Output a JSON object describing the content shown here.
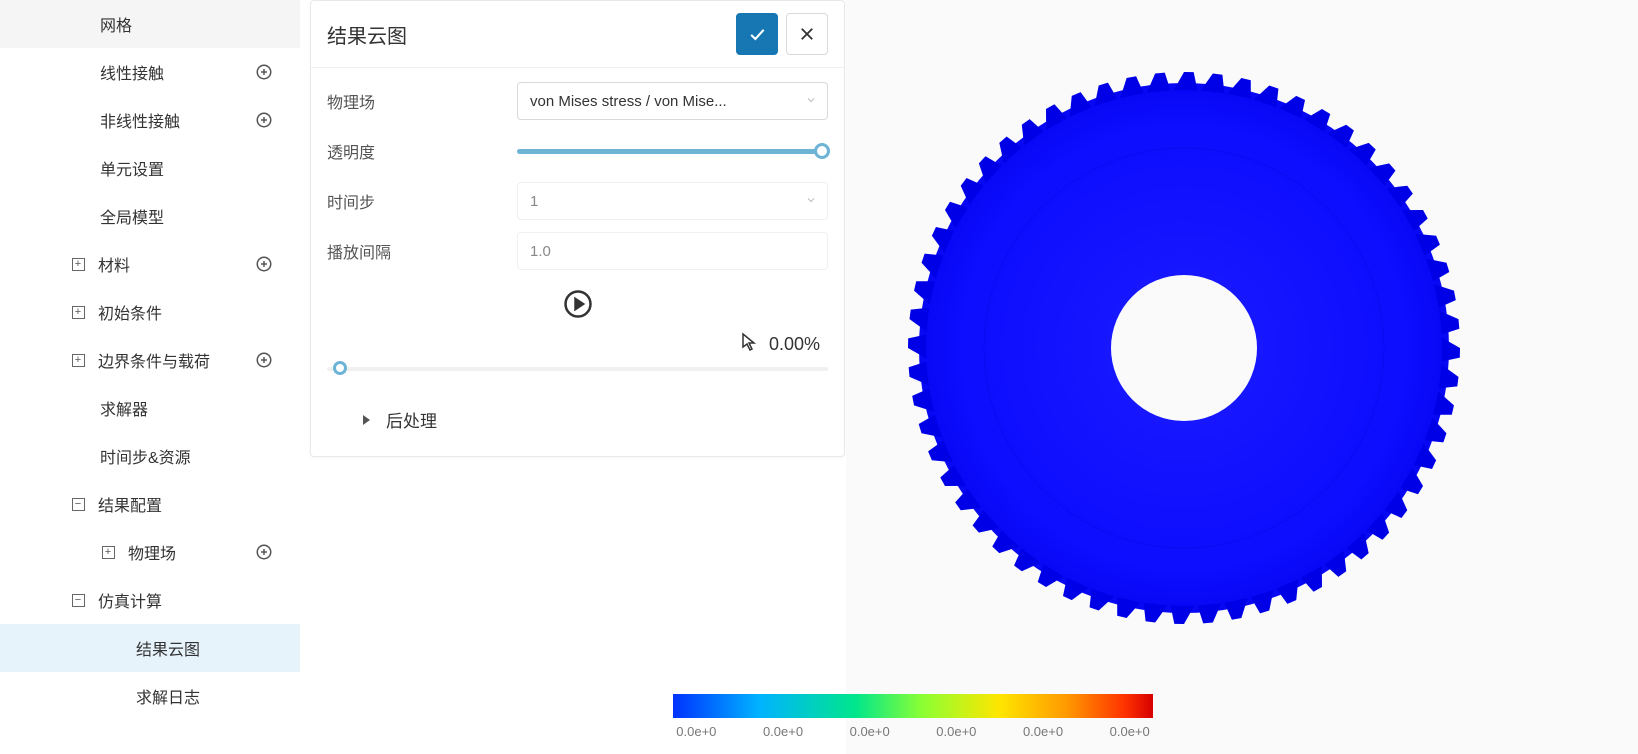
{
  "tree": {
    "items": [
      {
        "label": "网格",
        "indent": 1,
        "expand": null,
        "add": false
      },
      {
        "label": "线性接触",
        "indent": 1,
        "expand": null,
        "add": true
      },
      {
        "label": "非线性接触",
        "indent": 1,
        "expand": null,
        "add": true
      },
      {
        "label": "单元设置",
        "indent": 1,
        "expand": null,
        "add": false
      },
      {
        "label": "全局模型",
        "indent": 1,
        "expand": null,
        "add": false
      },
      {
        "label": "材料",
        "indent": 0,
        "expand": "plus",
        "add": true
      },
      {
        "label": "初始条件",
        "indent": 0,
        "expand": "plus",
        "add": false
      },
      {
        "label": "边界条件与载荷",
        "indent": 0,
        "expand": "plus",
        "add": true
      },
      {
        "label": "求解器",
        "indent": 1,
        "expand": null,
        "add": false
      },
      {
        "label": "时间步&资源",
        "indent": 1,
        "expand": null,
        "add": false
      },
      {
        "label": "结果配置",
        "indent": 0,
        "expand": "minus",
        "add": false
      },
      {
        "label": "物理场",
        "indent": 1,
        "expand": "plus",
        "add": true
      },
      {
        "label": "仿真计算",
        "indent": 0,
        "expand": "minus",
        "add": false
      },
      {
        "label": "结果云图",
        "indent": 2,
        "expand": null,
        "add": false,
        "active": true
      },
      {
        "label": "求解日志",
        "indent": 2,
        "expand": null,
        "add": false
      }
    ]
  },
  "panel": {
    "title": "结果云图",
    "fields": {
      "physics_label": "物理场",
      "physics_value": "von Mises stress / von Mise...",
      "opacity_label": "透明度",
      "timestep_label": "时间步",
      "timestep_value": "1",
      "interval_label": "播放间隔",
      "interval_value": "1.0"
    },
    "percent": "0.00%",
    "post_label": "后处理"
  },
  "colorbar": {
    "ticks": [
      "0.0e+0",
      "0.0e+0",
      "0.0e+0",
      "0.0e+0",
      "0.0e+0",
      "0.0e+0"
    ]
  }
}
